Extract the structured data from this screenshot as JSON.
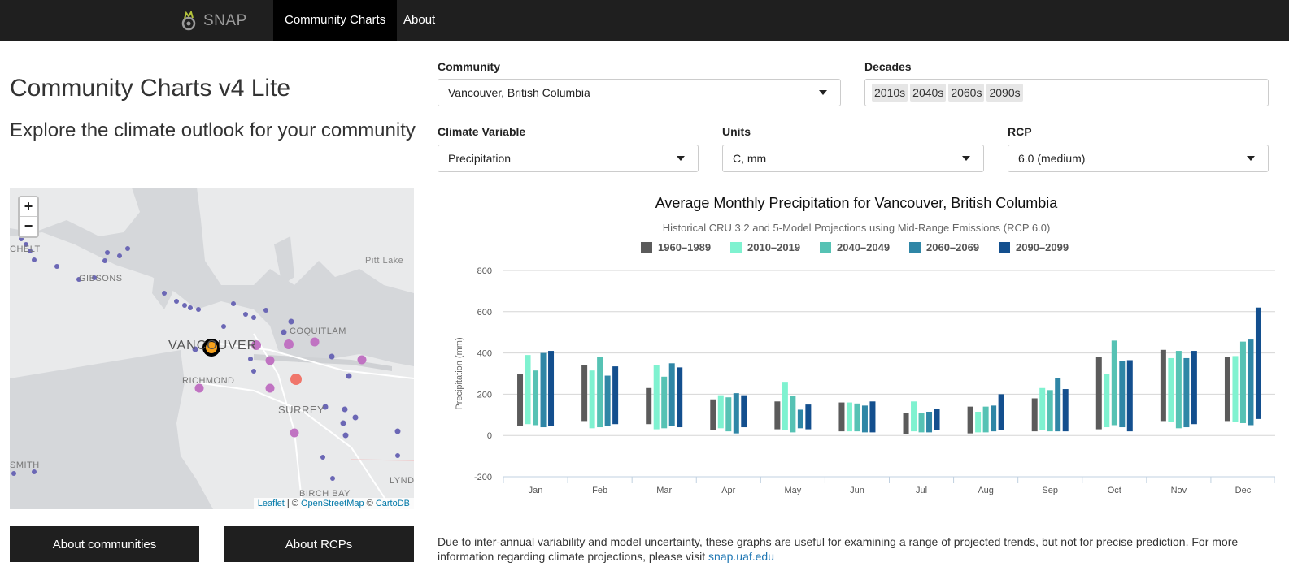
{
  "nav": {
    "brand": "SNAP",
    "tabs": [
      {
        "label": "Community Charts",
        "active": true
      },
      {
        "label": "About",
        "active": false
      }
    ]
  },
  "left": {
    "title": "Community Charts v4 Lite",
    "subtitle": "Explore the climate outlook for your community",
    "map": {
      "zoom_in": "+",
      "zoom_out": "−",
      "labels": {
        "chelt": "CHELT",
        "gibsons": "GIBSONS",
        "pitt_lake": "Pitt Lake",
        "vancouver": "VANCOUVER",
        "coquitlam": "COQUITLAM",
        "richmond": "RICHMOND",
        "surrey": "SURREY",
        "smith": "SMITH",
        "birch_bay": "BIRCH BAY",
        "lynd": "LYNDI"
      },
      "attribution": {
        "leaflet": "Leaflet",
        "sep1": " | © ",
        "osm": "OpenStreetMap",
        "sep2": " © ",
        "carto": "CartoDB"
      }
    },
    "buttons": {
      "about_communities": "About communities",
      "about_rcps": "About RCPs"
    }
  },
  "controls": {
    "community_label": "Community",
    "community_value": "Vancouver, British Columbia",
    "decades_label": "Decades",
    "decades": [
      "2010s",
      "2040s",
      "2060s",
      "2090s"
    ],
    "variable_label": "Climate Variable",
    "variable_value": "Precipitation",
    "units_label": "Units",
    "units_value": "C, mm",
    "rcp_label": "RCP",
    "rcp_value": "6.0 (medium)"
  },
  "colors": {
    "1960-1989": "#5b5b5b",
    "2010-2019": "#7ff2d0",
    "2040-2049": "#56c2b4",
    "2060-2069": "#2f86a6",
    "2090-2099": "#134f8e"
  },
  "chart_data": {
    "type": "bar",
    "title": "Average Monthly Precipitation for Vancouver, British Columbia",
    "subtitle": "Historical CRU 3.2 and 5-Model Projections using Mid-Range Emissions (RCP 6.0)",
    "ylabel": "Precipitation (mm)",
    "ylim": [
      -200,
      800
    ],
    "yticks": [
      -200,
      0,
      200,
      400,
      600,
      800
    ],
    "categories": [
      "Jan",
      "Feb",
      "Mar",
      "Apr",
      "May",
      "Jun",
      "Jul",
      "Aug",
      "Sep",
      "Oct",
      "Nov",
      "Dec"
    ],
    "series": [
      {
        "name": "1960–1989",
        "low": [
          45,
          70,
          55,
          25,
          30,
          20,
          5,
          10,
          20,
          30,
          70,
          70
        ],
        "high": [
          300,
          340,
          230,
          175,
          165,
          160,
          110,
          140,
          180,
          380,
          415,
          380
        ]
      },
      {
        "name": "2010–2019",
        "low": [
          55,
          35,
          30,
          35,
          25,
          20,
          20,
          15,
          25,
          40,
          65,
          65
        ],
        "high": [
          390,
          315,
          340,
          195,
          260,
          160,
          165,
          115,
          230,
          300,
          375,
          385
        ]
      },
      {
        "name": "2040–2049",
        "low": [
          50,
          40,
          35,
          20,
          15,
          20,
          15,
          15,
          20,
          50,
          35,
          60
        ],
        "high": [
          315,
          380,
          285,
          185,
          190,
          155,
          110,
          140,
          220,
          460,
          410,
          455
        ]
      },
      {
        "name": "2060–2069",
        "low": [
          40,
          45,
          45,
          10,
          35,
          15,
          15,
          20,
          20,
          40,
          40,
          50
        ],
        "high": [
          400,
          290,
          350,
          205,
          125,
          145,
          115,
          145,
          280,
          360,
          375,
          465
        ]
      },
      {
        "name": "2090–2099",
        "low": [
          45,
          55,
          40,
          40,
          30,
          15,
          25,
          25,
          20,
          20,
          55,
          80
        ],
        "high": [
          410,
          335,
          330,
          195,
          150,
          165,
          130,
          200,
          225,
          365,
          410,
          620
        ]
      }
    ]
  },
  "footnote": {
    "text": "Due to inter-annual variability and model uncertainty, these graphs are useful for examining a range of projected trends, but not for precise prediction. For more information regarding climate projections, please visit ",
    "link": "snap.uaf.edu"
  }
}
